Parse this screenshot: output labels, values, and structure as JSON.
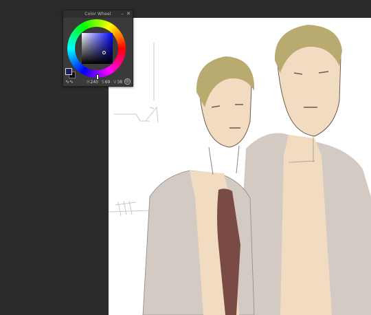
{
  "palette": {
    "title": "Color Wheel",
    "minimize_label": "–",
    "close_label": "✕",
    "values": {
      "hue_label": "H",
      "hue": "240",
      "saturation_label": "S",
      "saturation": "69",
      "value_label": "V",
      "value": "38"
    },
    "main_color": "#1c1f5e",
    "sub_color": "#0b0b16",
    "icons": {
      "mode": "waveform-icon",
      "settings": "gear-icon"
    }
  },
  "colors": {
    "workspace": "#2c2c2c",
    "canvas": "#ffffff",
    "hair": "#b9aa6f",
    "skin": "#f1dcc2",
    "coat": "#d4cac4",
    "tie": "#7a4b45"
  }
}
